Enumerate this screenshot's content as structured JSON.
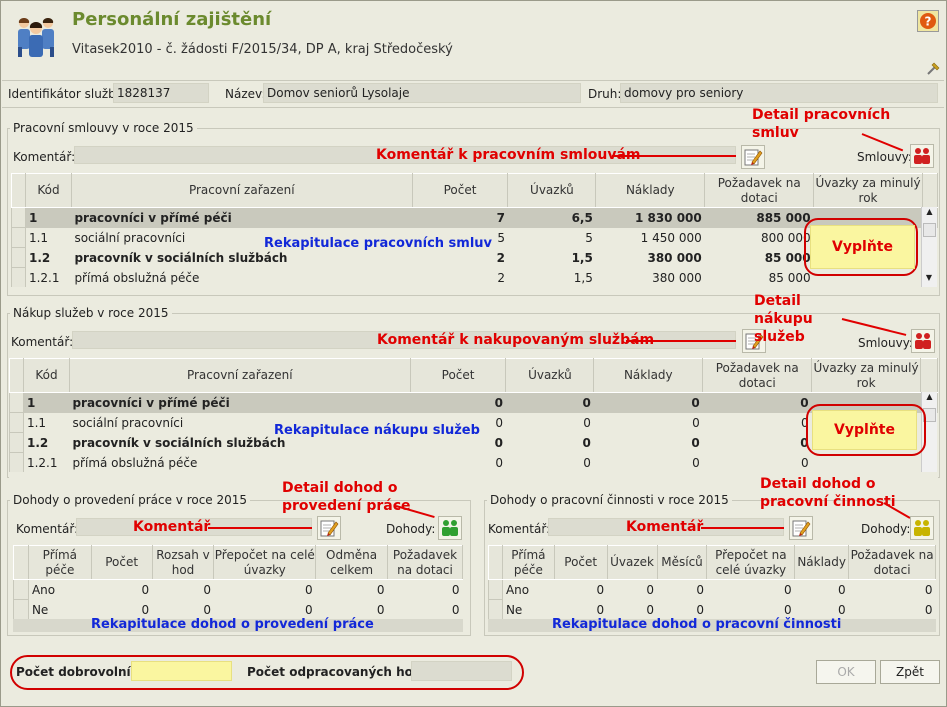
{
  "header": {
    "title": "Personální zajištění",
    "subtitle": "Vitasek2010 - č. žádosti F/2015/34, DP A, kraj Středočeský"
  },
  "info": {
    "id_label": "Identifikátor služby:",
    "id_value": "1828137",
    "name_label": "Název:",
    "name_value": "Domov seniorů Lysolaje",
    "type_label": "Druh:",
    "type_value": "domovy pro seniory"
  },
  "contracts": {
    "title": "Pracovní smlouvy v roce 2015",
    "comment_label": "Komentář:",
    "comment_annot": "Komentář k pracovním smlouvám",
    "detail_annot": "Detail pracovních smluv",
    "contracts_label": "Smlouvy:",
    "summary_annot": "Rekapitulace pracovních smluv",
    "fill_annot": "Vyplňte",
    "headers": [
      "Kód",
      "Pracovní zařazení",
      "Počet",
      "Úvazků",
      "Náklady",
      "Požadavek na dotaci",
      "Úvazky za minulý rok"
    ],
    "rows": [
      [
        "1",
        "pracovníci v přímé péči",
        "7",
        "6,5",
        "1 830 000",
        "885 000",
        ""
      ],
      [
        "1.1",
        "sociální pracovníci",
        "5",
        "5",
        "1 450 000",
        "800 000",
        ""
      ],
      [
        "1.2",
        "pracovník v sociálních službách",
        "2",
        "1,5",
        "380 000",
        "85 000",
        ""
      ],
      [
        "1.2.1",
        "přímá obslužná péče",
        "2",
        "1,5",
        "380 000",
        "85 000",
        ""
      ]
    ]
  },
  "services": {
    "title": "Nákup služeb v roce 2015",
    "comment_label": "Komentář:",
    "comment_annot": "Komentář k nakupovaným službám",
    "detail_annot": "Detail nákupu služeb",
    "contracts_label": "Smlouvy:",
    "summary_annot": "Rekapitulace nákupu služeb",
    "fill_annot": "Vyplňte",
    "headers": [
      "Kód",
      "Pracovní zařazení",
      "Počet",
      "Úvazků",
      "Náklady",
      "Požadavek na dotaci",
      "Úvazky za minulý rok"
    ],
    "rows": [
      [
        "1",
        "pracovníci v přímé péči",
        "0",
        "0",
        "0",
        "0",
        ""
      ],
      [
        "1.1",
        "sociální pracovníci",
        "0",
        "0",
        "0",
        "0",
        ""
      ],
      [
        "1.2",
        "pracovník v sociálních službách",
        "0",
        "0",
        "0",
        "0",
        ""
      ],
      [
        "1.2.1",
        "přímá obslužná péče",
        "0",
        "0",
        "0",
        "0",
        ""
      ]
    ]
  },
  "dpp": {
    "title": "Dohody o provedení práce v roce 2015",
    "comment_label": "Komentář:",
    "comment_annot": "Komentář",
    "detail_annot": "Detail dohod o provedení práce",
    "agreements_label": "Dohody:",
    "summary_annot": "Rekapitulace dohod o provedení práce",
    "headers": [
      "Přímá péče",
      "Počet",
      "Rozsah v hod",
      "Přepočet na celé úvazky",
      "Odměna celkem",
      "Požadavek na dotaci"
    ],
    "rows": [
      [
        "Ano",
        "0",
        "0",
        "0",
        "0",
        "0"
      ],
      [
        "Ne",
        "0",
        "0",
        "0",
        "0",
        "0"
      ]
    ]
  },
  "dpc": {
    "title": "Dohody o pracovní činnosti v roce 2015",
    "comment_label": "Komentář:",
    "comment_annot": "Komentář",
    "detail_annot": "Detail dohod o pracovní činnosti",
    "agreements_label": "Dohody:",
    "summary_annot": "Rekapitulace dohod o pracovní činnosti",
    "headers": [
      "Přímá péče",
      "Počet",
      "Úvazek",
      "Měsíců",
      "Přepočet na celé úvazky",
      "Náklady",
      "Požadavek na dotaci"
    ],
    "rows": [
      [
        "Ano",
        "0",
        "0",
        "0",
        "0",
        "0",
        "0"
      ],
      [
        "Ne",
        "0",
        "0",
        "0",
        "0",
        "0",
        "0"
      ]
    ]
  },
  "footer": {
    "volunteers_label": "Počet dobrovolníků:",
    "hours_label": "Počet odpracovaných hodin:",
    "ok": "OK",
    "back": "Zpět"
  },
  "colors": {
    "title": "#6b8a2e",
    "annotation_red": "#e00000",
    "annotation_blue": "#1228d8",
    "highlight_yellow": "#faf6a0"
  }
}
